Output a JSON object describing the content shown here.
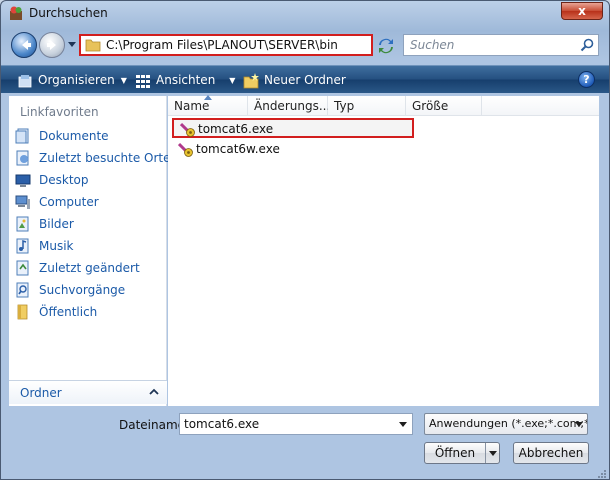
{
  "window": {
    "title": "Durchsuchen",
    "close_label": "x"
  },
  "nav": {
    "address_path": "C:\\Program Files\\PLANOUT\\SERVER\\bin",
    "search_placeholder": "Suchen"
  },
  "toolbar": {
    "organize_label": "Organisieren",
    "views_label": "Ansichten",
    "new_folder_label": "Neuer Ordner",
    "help_label": "?"
  },
  "sidebar": {
    "heading": "Linkfavoriten",
    "items": [
      {
        "label": "Dokumente",
        "icon": "documents-icon"
      },
      {
        "label": "Zuletzt besuchte Orte",
        "icon": "recent-places-icon"
      },
      {
        "label": "Desktop",
        "icon": "desktop-icon"
      },
      {
        "label": "Computer",
        "icon": "computer-icon"
      },
      {
        "label": "Bilder",
        "icon": "pictures-icon"
      },
      {
        "label": "Musik",
        "icon": "music-icon"
      },
      {
        "label": "Zuletzt geändert",
        "icon": "recently-changed-icon"
      },
      {
        "label": "Suchvorgänge",
        "icon": "searches-icon"
      },
      {
        "label": "Öffentlich",
        "icon": "public-folder-icon"
      }
    ],
    "folders_label": "Ordner"
  },
  "files": {
    "columns": [
      "Name",
      "Änderungs...",
      "Typ",
      "Größe"
    ],
    "rows": [
      {
        "name": "tomcat6.exe",
        "selected": true
      },
      {
        "name": "tomcat6w.exe",
        "selected": false
      }
    ]
  },
  "bottom": {
    "filename_label": "Dateiname:",
    "filename_value": "tomcat6.exe",
    "filter_value": "Anwendungen (*.exe;*.com;*.",
    "open_label": "Öffnen",
    "cancel_label": "Abbrechen"
  },
  "colors": {
    "highlight_border": "#d21e1e",
    "toolbar_bg": "#244f80",
    "link_text": "#1b5aa8"
  }
}
